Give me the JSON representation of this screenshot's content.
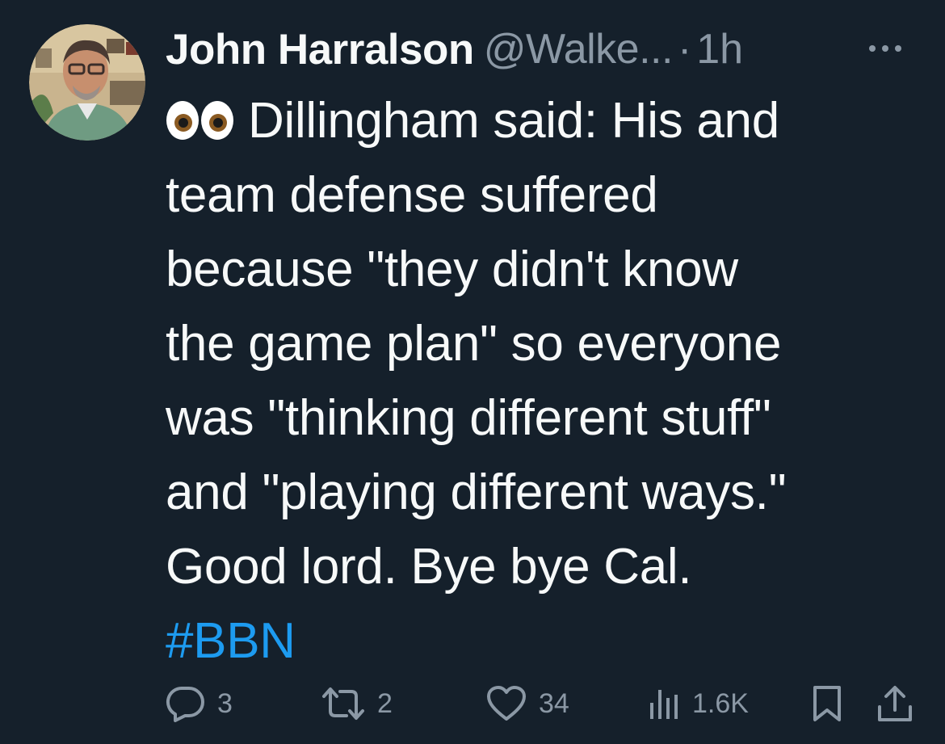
{
  "tweet": {
    "author_name": "John Harralson",
    "handle": "@Walke...",
    "separator": "·",
    "time": "1h",
    "emoji_icon": "eyes-emoji",
    "text_lines": [
      "Dillingham said: His and",
      "team defense suffered",
      "because \"they didn't know",
      "the game plan\" so everyone",
      "was \"thinking different stuff\"",
      "and \"playing different ways.\"",
      "Good lord. Bye bye Cal."
    ],
    "hashtag": "#BBN"
  },
  "actions": {
    "reply_count": "3",
    "retweet_count": "2",
    "like_count": "34",
    "views_count": "1.6K"
  },
  "colors": {
    "background": "#15202b",
    "text_primary": "#f7f9f9",
    "text_secondary": "#8b98a5",
    "accent": "#1d9bf0"
  }
}
